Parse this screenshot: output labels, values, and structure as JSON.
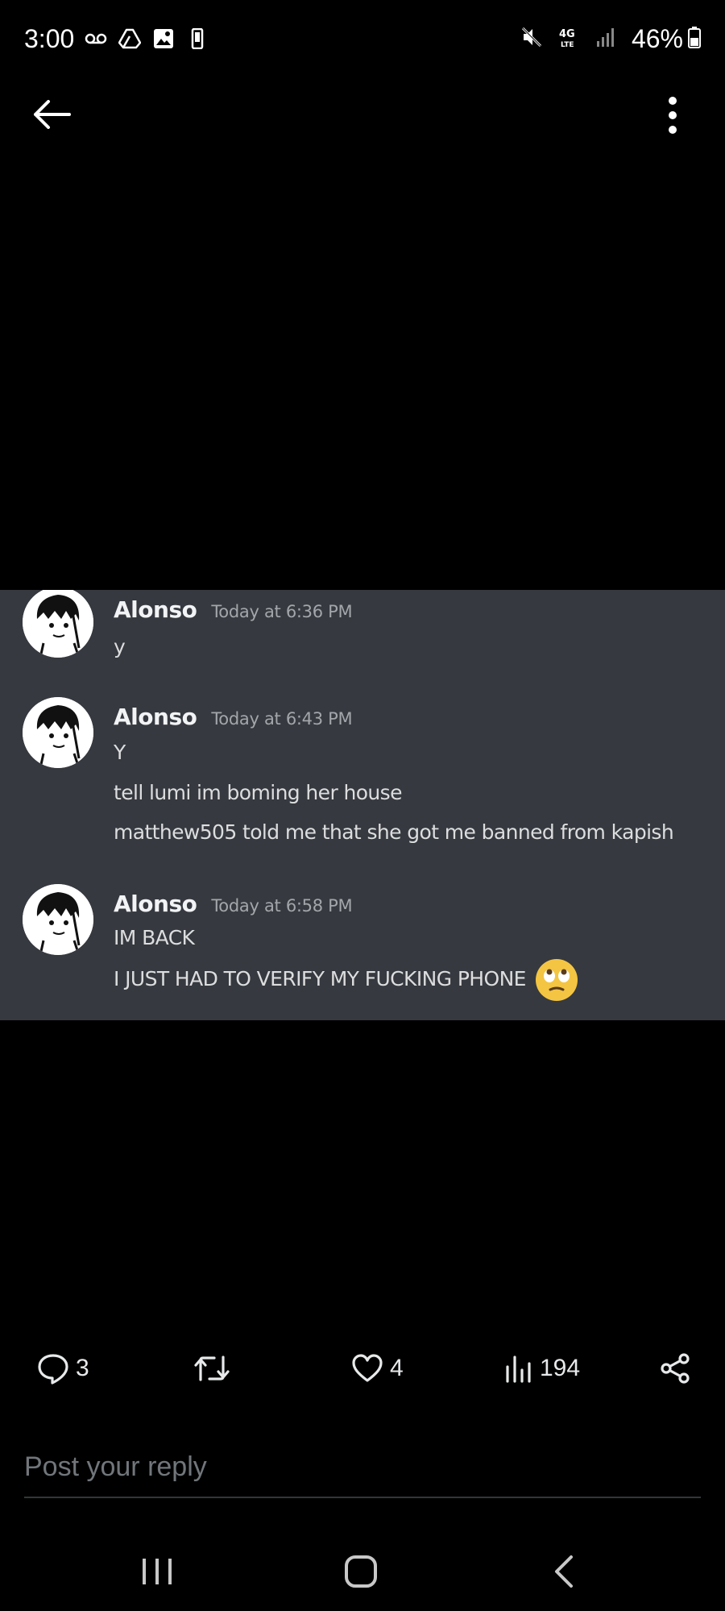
{
  "status_bar": {
    "time": "3:00",
    "battery": "46%",
    "network": "4G LTE",
    "icons": [
      "voicemail-icon",
      "drive-icon",
      "gallery-icon",
      "phone-icon",
      "mute-icon",
      "signal-icon",
      "battery-icon"
    ]
  },
  "top_bar": {
    "back_icon": "arrow-left-icon",
    "more_icon": "more-vertical-icon"
  },
  "chat": {
    "messages": [
      {
        "author": "Alonso",
        "time": "Today at 6:36 PM",
        "lines": [
          "y"
        ]
      },
      {
        "author": "Alonso",
        "time": "Today at 6:43 PM",
        "lines": [
          "Y",
          "tell lumi im boming her house",
          "matthew505 told me that she got me banned from kapish"
        ]
      },
      {
        "author": "Alonso",
        "time": "Today at 6:58 PM",
        "lines": [
          "IM BACK",
          "I JUST HAD TO VERIFY MY FUCKING PHONE"
        ],
        "emoji": "eye-roll-emoji"
      }
    ],
    "colors": {
      "background": "#36393f",
      "author": "#f2f3f5",
      "time": "#a3a6aa",
      "text": "#dcddde"
    }
  },
  "actions": {
    "replies": "3",
    "retweets": "",
    "likes": "4",
    "views": "194",
    "share_icon": "share-icon"
  },
  "reply": {
    "placeholder": "Post your reply"
  },
  "nav_bar": {
    "icons": [
      "recents-icon",
      "home-icon",
      "back-icon"
    ]
  }
}
